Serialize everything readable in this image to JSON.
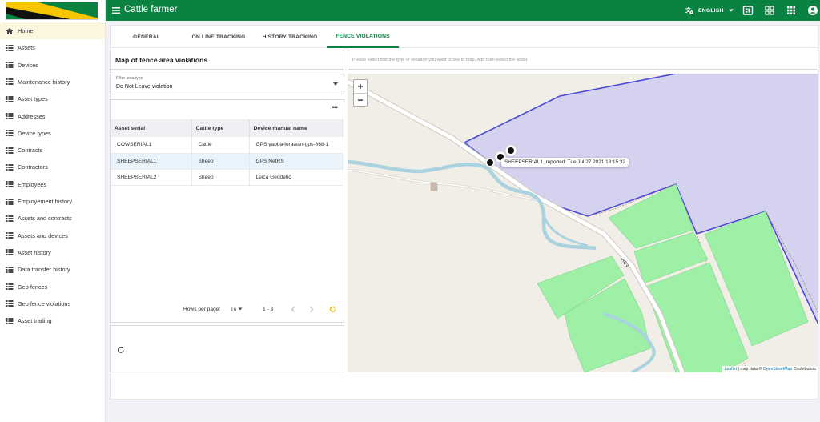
{
  "app": {
    "title": "Cattle farmer",
    "language": "ENGLISH"
  },
  "sidebar": {
    "items": [
      {
        "label": "Home",
        "icon": "home-icon"
      },
      {
        "label": "Assets",
        "icon": "list-icon"
      },
      {
        "label": "Devices",
        "icon": "list-icon"
      },
      {
        "label": "Maintenance history",
        "icon": "list-icon"
      },
      {
        "label": "Asset types",
        "icon": "list-icon"
      },
      {
        "label": "Addresses",
        "icon": "list-icon"
      },
      {
        "label": "Device types",
        "icon": "list-icon"
      },
      {
        "label": "Contracts",
        "icon": "list-icon"
      },
      {
        "label": "Contractors",
        "icon": "list-icon"
      },
      {
        "label": "Employees",
        "icon": "list-icon"
      },
      {
        "label": "Employement history",
        "icon": "list-icon"
      },
      {
        "label": "Assets and contracts",
        "icon": "list-icon"
      },
      {
        "label": "Assets and devices",
        "icon": "list-icon"
      },
      {
        "label": "Asset history",
        "icon": "list-icon"
      },
      {
        "label": "Data transfer history",
        "icon": "list-icon"
      },
      {
        "label": "Geo fences",
        "icon": "list-icon"
      },
      {
        "label": "Geo fence violations",
        "icon": "list-icon"
      },
      {
        "label": "Asset trading",
        "icon": "list-icon"
      }
    ]
  },
  "tabs": [
    {
      "label": "GENERAL"
    },
    {
      "label": "ON LINE TRACKING"
    },
    {
      "label": "HISTORY TRACKING"
    },
    {
      "label": "FENCE VIOLATIONS"
    }
  ],
  "panel": {
    "title": "Map of fence area violations",
    "hint": "Please select first the type of violation you want to see in map. Add then select the asset.",
    "filter": {
      "label": "Filter area type",
      "value": "Do Not Leave violation"
    }
  },
  "table": {
    "columns": [
      "Asset serial",
      "Cattle type",
      "Device manual name"
    ],
    "rows": [
      [
        "COWSERIAL1",
        "Cattle",
        "GPS yabba-lorawan-gps-868-1"
      ],
      [
        "SHEEPSERIAL1",
        "Sheep",
        "GPS NetRS"
      ],
      [
        "SHEEPSERIAL2",
        "Sheep",
        "Leica Geodetic"
      ]
    ],
    "pager": {
      "rows_per_page_label": "Rows per page:",
      "rows_per_page": "10",
      "range": "1 - 3"
    }
  },
  "map": {
    "popup": "SHEEPSERIAL1, reported: Tue Jul 27 2021 18:15:32",
    "road_label": "R83",
    "attribution": {
      "leaflet": "Leaflet",
      "sep": " | map data © ",
      "osm": "OpenStreetMap",
      "contrib": " Contributors"
    }
  },
  "colors": {
    "brand": "#0a8342",
    "fence": "#4a4ad8",
    "fence_fill": "#d5d2f0",
    "field": "#9ef0a6",
    "water": "#aad3df"
  }
}
